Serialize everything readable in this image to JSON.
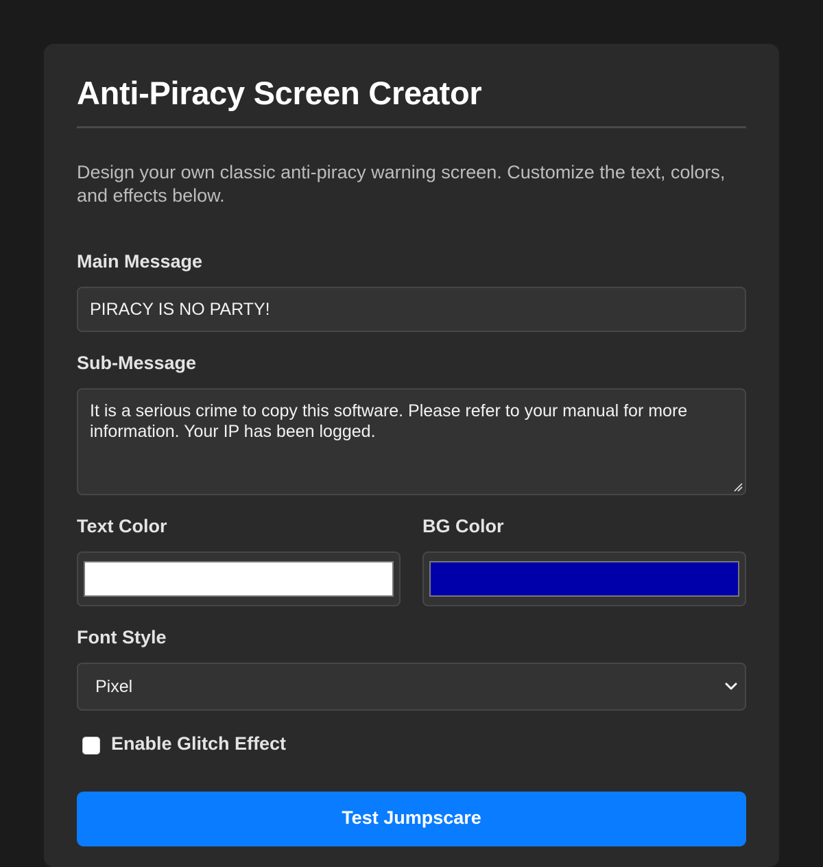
{
  "form": {
    "title": "Anti-Piracy Screen Creator",
    "description": "Design your own classic anti-piracy warning screen. Customize the text, colors, and effects below.",
    "main_message": {
      "label": "Main Message",
      "value": "PIRACY IS NO PARTY!"
    },
    "sub_message": {
      "label": "Sub-Message",
      "value": "It is a serious crime to copy this software. Please refer to your manual for more information. Your IP has been logged."
    },
    "text_color": {
      "label": "Text Color",
      "value": "#ffffff"
    },
    "bg_color": {
      "label": "BG Color",
      "value": "#0000aa"
    },
    "font_style": {
      "label": "Font Style",
      "selected": "Pixel",
      "icon": "chevron-down-icon"
    },
    "glitch": {
      "label": "Enable Glitch Effect",
      "checked": false
    },
    "submit_label": "Test Jumpscare"
  },
  "colors": {
    "page_background": "#1b1b1b",
    "card_background": "#2a2a2a",
    "accent": "#0a7cff"
  }
}
